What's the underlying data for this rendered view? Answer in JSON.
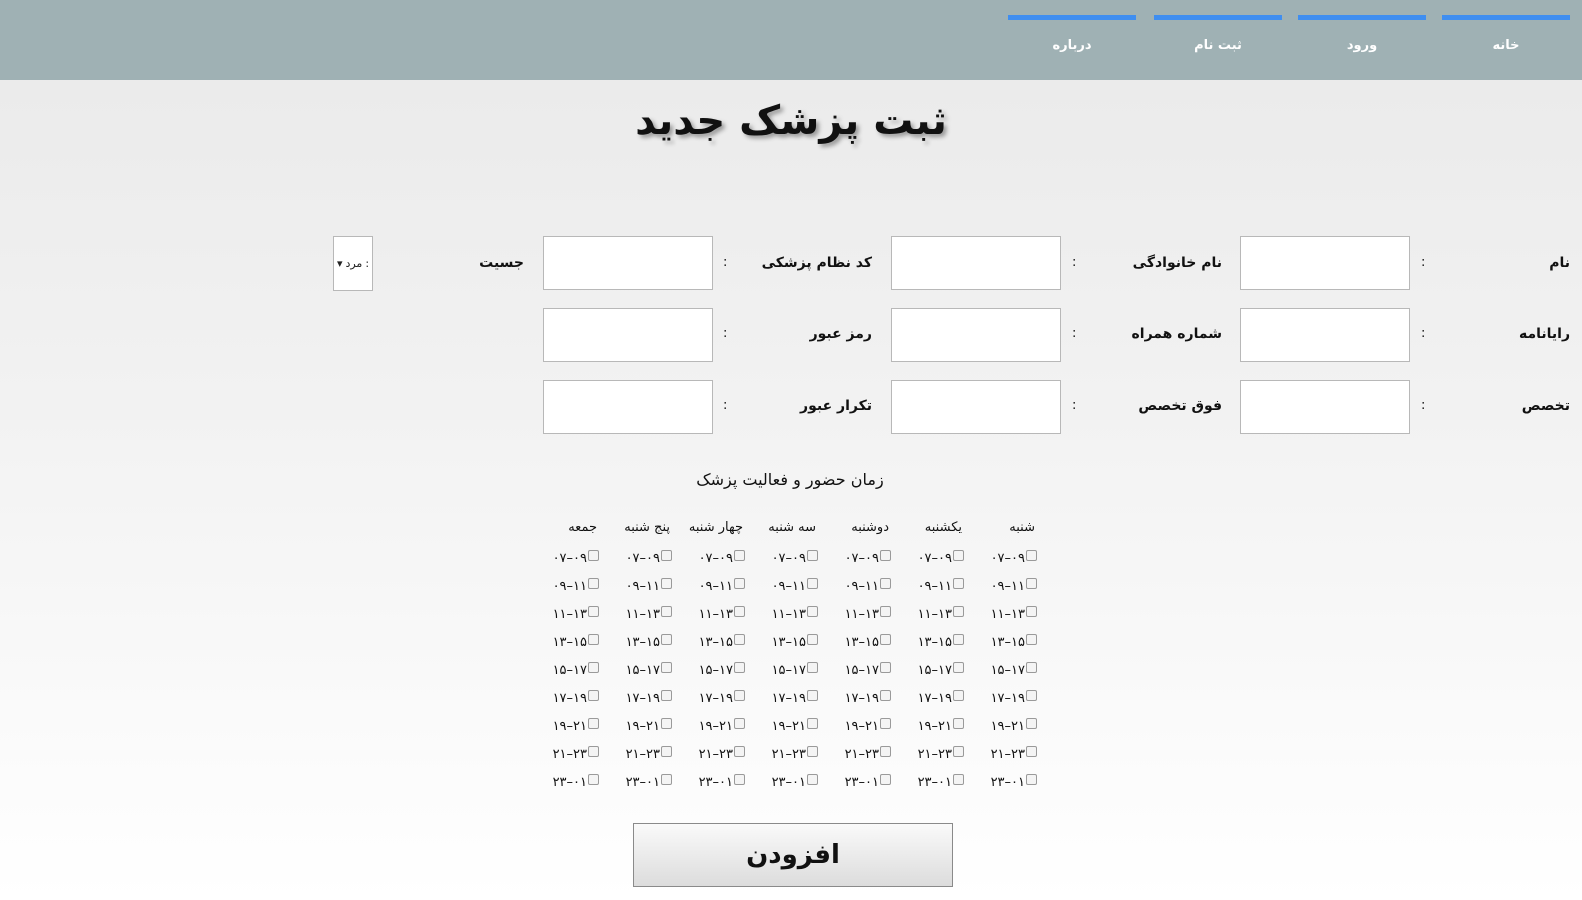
{
  "nav": {
    "items": [
      {
        "label": "خانه"
      },
      {
        "label": "ورود"
      },
      {
        "label": "ثبت نام"
      },
      {
        "label": "درباره"
      }
    ]
  },
  "page_title": "ثبت پزشک جدید",
  "form": {
    "colon": ":",
    "fields": {
      "name": "نام",
      "last_name": "نام خانوادگی",
      "medical_code": "کد نظام پزشکی",
      "gender": "جسیت",
      "email": "رایانامه",
      "mobile": "شماره همراه",
      "password": "رمز عبور",
      "specialty": "تخصص",
      "subspecialty": "فوق تخصص",
      "password_repeat": "تکرار عبور"
    },
    "gender_select": {
      "selected": "مرد",
      "colon": ":"
    }
  },
  "schedule": {
    "title": "زمان حضور و فعالیت پزشک",
    "days": [
      "شنبه",
      "یکشنبه",
      "دوشنبه",
      "سه شنبه",
      "چهار شنبه",
      "پنج شنبه",
      "جمعه"
    ],
    "slots": [
      "۰۷–۰۹",
      "۰۹–۱۱",
      "۱۱–۱۳",
      "۱۳–۱۵",
      "۱۵–۱۷",
      "۱۷–۱۹",
      "۱۹–۲۱",
      "۲۱–۲۳",
      "۲۳–۰۱"
    ]
  },
  "submit_label": "افزودن",
  "colors": {
    "navbar": "#9fb1b4",
    "nav_accent": "#3f8ef0"
  }
}
